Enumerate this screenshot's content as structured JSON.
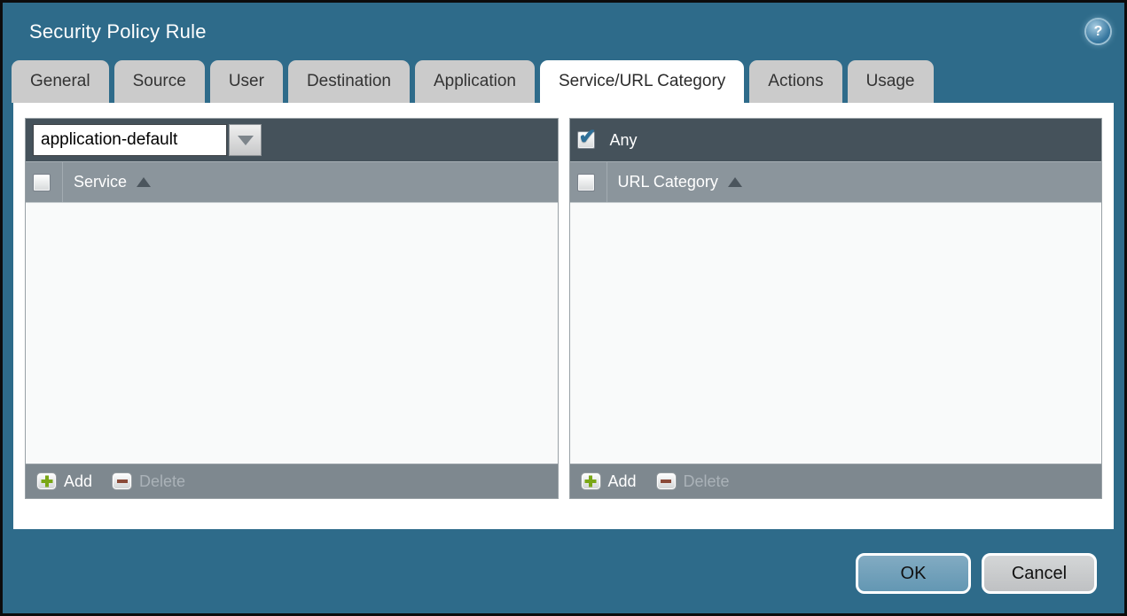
{
  "window": {
    "title": "Security Policy Rule",
    "help_icon_glyph": "?"
  },
  "tabs": [
    {
      "label": "General",
      "active": false
    },
    {
      "label": "Source",
      "active": false
    },
    {
      "label": "User",
      "active": false
    },
    {
      "label": "Destination",
      "active": false
    },
    {
      "label": "Application",
      "active": false
    },
    {
      "label": "Service/URL Category",
      "active": true
    },
    {
      "label": "Actions",
      "active": false
    },
    {
      "label": "Usage",
      "active": false
    }
  ],
  "active_tab": "Service/URL Category",
  "service_panel": {
    "service_type_value": "application-default",
    "column_header": "Service",
    "sort_direction": "ascending",
    "select_all_checked": false,
    "rows": [],
    "add_label": "Add",
    "delete_label": "Delete",
    "delete_enabled": false
  },
  "url_category_panel": {
    "any_label": "Any",
    "any_checked": true,
    "column_header": "URL Category",
    "sort_direction": "ascending",
    "select_all_checked": false,
    "rows": [],
    "add_label": "Add",
    "delete_label": "Delete",
    "delete_enabled": false
  },
  "actions": {
    "ok_label": "OK",
    "cancel_label": "Cancel"
  },
  "colors": {
    "dialog_background": "#2e6b8a",
    "outer_border": "#0c0c0c",
    "tab_inactive": "#cbcbcb",
    "tab_active": "#ffffff",
    "panel_toolbar_dark": "#45525b",
    "panel_header_gray": "#8b959c",
    "panel_footer_gray": "#7e888f",
    "panel_body": "#f9fafa",
    "check_blue": "#2f6f97",
    "add_plus_green": "#7aa716",
    "delete_minus_red": "#8a4a38",
    "ok_button_blue": "#6f9fb9",
    "cancel_button_gray": "#c7c9cb"
  }
}
